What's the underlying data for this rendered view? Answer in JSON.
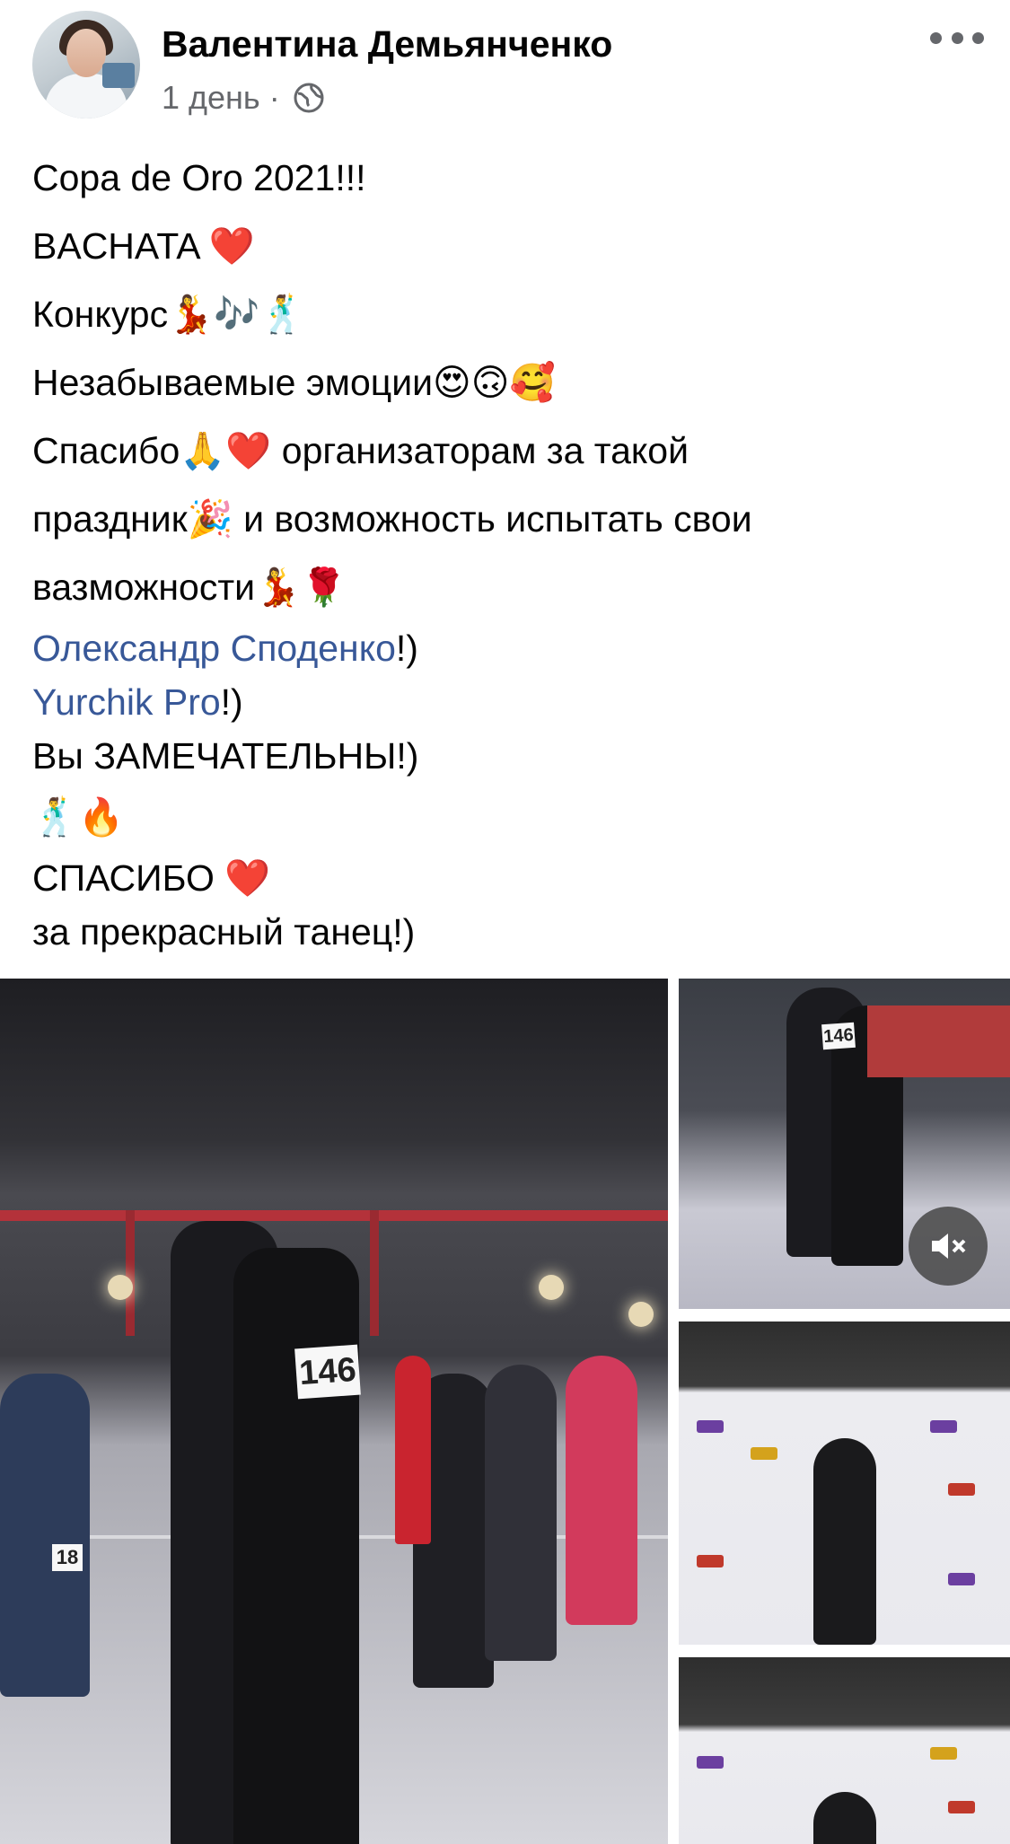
{
  "post": {
    "author": "Валентина Демьянченко",
    "time": "1 день",
    "separator": "·",
    "privacy_icon": "globe-icon",
    "more_icon": "more-horizontal-icon",
    "lines": {
      "l1": "Copa de Oro 2021!!!",
      "l2": "BACHATA ❤️",
      "l3": "Конкурс💃🎶🕺",
      "l4": "Незабываемые эмоции😍🙃🥰",
      "l5": " Спасибо🙏❤️ организаторам за такой",
      "l6": "праздник🎉 и возможность испытать свои",
      "l7": "вазможности💃🌹",
      "l8_link": "Олександр Споденко",
      "l8_suffix": "!)",
      "l9_link": "Yurchik Pro",
      "l9_suffix": "!)",
      "l10": "Вы ЗАМЕЧАТЕЛЬНЫ!)",
      "l11": "🕺🔥",
      "l12": "СПАСИБО ❤️",
      "l13": "за прекрасный танец!)"
    }
  },
  "media": {
    "main_badge": "146",
    "side_badge": "146",
    "bg_badge": "18",
    "mute_icon": "speaker-muted-icon"
  },
  "colors": {
    "link": "#385898",
    "meta": "#65676b",
    "text": "#050505"
  }
}
